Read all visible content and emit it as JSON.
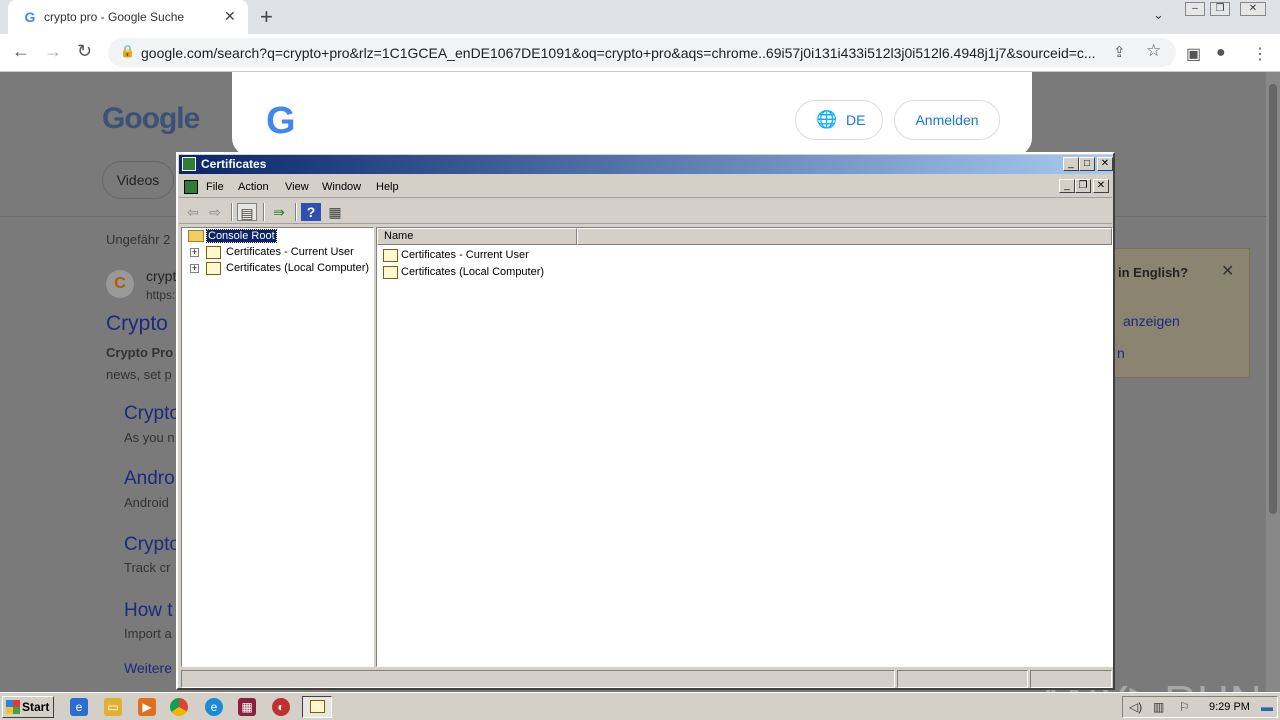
{
  "browser": {
    "tab_title": "crypto pro - Google Suche",
    "url": "google.com/search?q=crypto+pro&rlz=1C1GCEA_enDE1067DE1091&oq=crypto+pro&aqs=chrome..69i57j0i131i433i512l3j0i512l6.4948j1j7&sourceid=c..."
  },
  "google": {
    "logo": "Google",
    "filter_pill": "Videos",
    "results_count": "Ungefähr 2",
    "site_name": "crypt",
    "site_url": "https:",
    "result_title": "Crypto",
    "snippet_bold": "Crypto Pro",
    "snippet2": "news, set p",
    "sub_results": [
      {
        "title": "Crypto",
        "snippet": "As you n"
      },
      {
        "title": "Andro",
        "snippet": "Android"
      },
      {
        "title": "Crypto",
        "snippet": "Track cr"
      },
      {
        "title": "How t",
        "snippet": "Import a"
      }
    ],
    "more_link": "Weitere",
    "consent": {
      "lang_button": "DE",
      "login_button": "Anmelden"
    },
    "translate": {
      "question": "in English?",
      "show": "anzeigen",
      "n": "n"
    }
  },
  "watermark": "ANY▷RUN",
  "mmc": {
    "title": "Certificates",
    "menu": [
      "File",
      "Action",
      "View",
      "Window",
      "Help"
    ],
    "tree": {
      "root": "Console Root",
      "items": [
        "Certificates - Current User",
        "Certificates (Local Computer)"
      ]
    },
    "list": {
      "column_name": "Name",
      "rows": [
        "Certificates - Current User",
        "Certificates (Local Computer)"
      ]
    }
  },
  "taskbar": {
    "start": "Start",
    "clock": "9:29 PM"
  }
}
